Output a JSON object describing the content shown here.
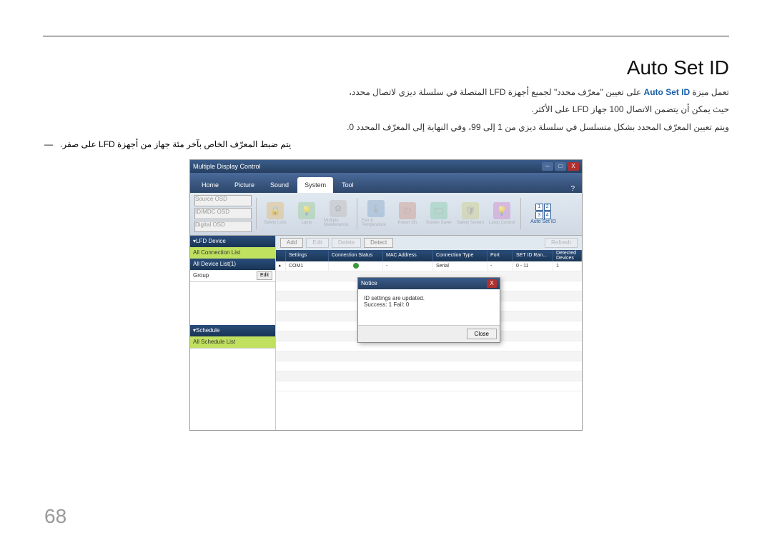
{
  "pageNumber": "68",
  "title": "Auto Set ID",
  "desc1_pre": "تعمل ميزة ",
  "desc1_feature": "Auto Set ID",
  "desc1_post": " على تعيين \"معرّف محدد\" لجميع أجهزة LFD المتصلة في سلسلة ديزي لاتصال محدد،",
  "desc2": "حيث يمكن أن يتضمن الاتصال 100 جهاز LFD على الأكثر.",
  "desc3": "ويتم تعيين المعرّف المحدد بشكل متسلسل في سلسلة ديزي من 1 إلى 99، وفي النهاية إلى المعرّف المحدد 0.",
  "mark": "يتم ضبط المعرّف الخاص بآخر مئة جهاز من أجهزة LFD على صفر.",
  "win": {
    "title": "Multiple Display Control",
    "tabs": {
      "home": "Home",
      "picture": "Picture",
      "sound": "Sound",
      "system": "System",
      "tool": "Tool"
    },
    "ribbon": {
      "g1": {
        "r1": "Source OSD",
        "r2": "ID/MDC OSD",
        "r3": "Digital OSD",
        "v1": "",
        "v2": ""
      },
      "icons": [
        "Safety Lock",
        "Lamp",
        "Multiple Maintenance",
        "Fan & Temperature",
        "Power On",
        "Screen Saver",
        "Safety Screen",
        "Lamp Control"
      ],
      "autoSet": "Auto Set ID"
    },
    "toolbar": {
      "add": "Add",
      "edit": "Edit",
      "delete": "Delete",
      "detect": "Detect",
      "refresh": "Refresh"
    },
    "sidebar": {
      "lfd": "LFD Device",
      "allConn": "All Connection List",
      "allDev": "All Device List(1)",
      "group": "Group",
      "edit": "Edit",
      "schedule": "Schedule",
      "allSched": "All Schedule List"
    },
    "table": {
      "headers": {
        "h0": "",
        "h1": "Settings",
        "h2": "Connection Status",
        "h3": "MAC Address",
        "h4": "Connection Type",
        "h5": "Port",
        "h6": "SET ID Ran...",
        "h7": "Detected Devices"
      },
      "row1": {
        "c1": "COM1",
        "c3": "-",
        "c4": "Serial",
        "c5": "-",
        "c6": "0 - 11",
        "c7": "1"
      }
    },
    "dialog": {
      "title": "Notice",
      "line1": "ID settings are updated.",
      "line2": "Success: 1   Fail: 0",
      "close": "Close"
    }
  }
}
